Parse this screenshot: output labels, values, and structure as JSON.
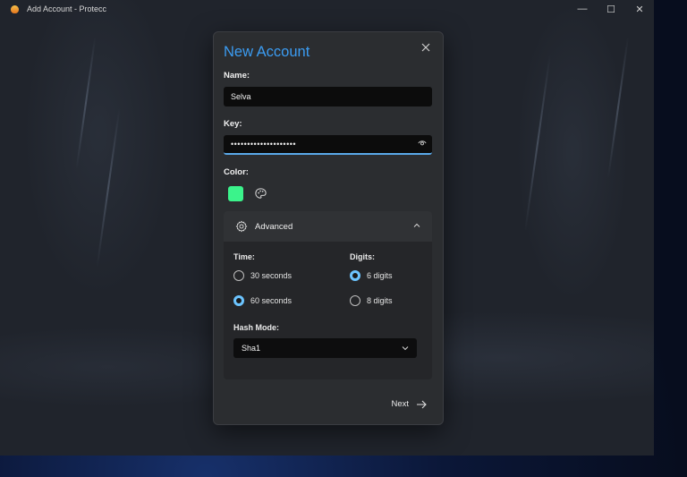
{
  "window": {
    "title": "Add Account - Protecc",
    "controls": {
      "minimize": "—",
      "maximize": "☐",
      "close": "✕"
    }
  },
  "dialog": {
    "title": "New Account",
    "close_icon": "close-icon",
    "name": {
      "label": "Name:",
      "value": "Selva"
    },
    "key": {
      "label": "Key:",
      "value": "••••••••••••••••••••",
      "reveal_icon": "eye-icon"
    },
    "color": {
      "label": "Color:",
      "swatch": "#3bf38b",
      "picker_icon": "palette-icon"
    },
    "advanced": {
      "title": "Advanced",
      "icon": "gear-icon",
      "expanded": true,
      "time": {
        "label": "Time:",
        "options": [
          "30 seconds",
          "60 seconds"
        ],
        "selected": "60 seconds"
      },
      "digits": {
        "label": "Digits:",
        "options": [
          "6 digits",
          "8 digits"
        ],
        "selected": "6 digits"
      },
      "hash_mode": {
        "label": "Hash Mode:",
        "value": "Sha1"
      }
    },
    "next_label": "Next",
    "accent": "#3b9cf2"
  }
}
